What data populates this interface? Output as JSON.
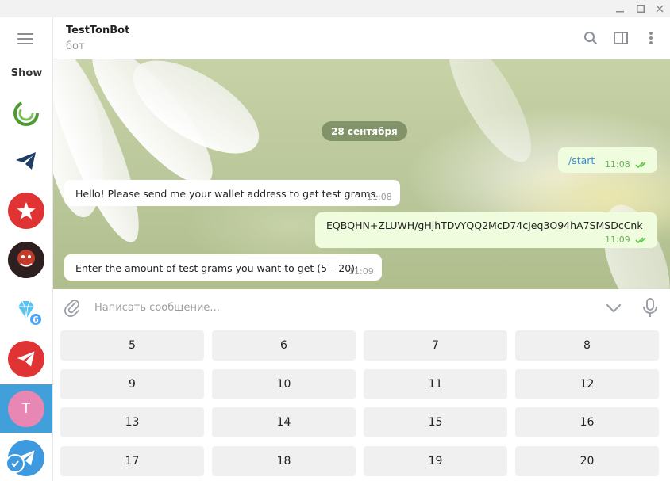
{
  "window": {
    "controls": [
      "minimize",
      "maximize",
      "close"
    ]
  },
  "sidebar": {
    "menu_icon": "hamburger-menu-icon",
    "show_label": "Show",
    "chats": [
      {
        "name": "chat-folder-green",
        "icon": "green-swirl-logo",
        "color": "#5a9a3c"
      },
      {
        "name": "chat-telegram-dark",
        "icon": "paper-plane-icon",
        "color": "#1f3e66"
      },
      {
        "name": "chat-star",
        "icon": "star-icon",
        "color": "#e03434"
      },
      {
        "name": "chat-avatar-photo",
        "icon": "photo-avatar",
        "color": "#3a2a2a"
      },
      {
        "name": "chat-diamond",
        "icon": "diamond-icon",
        "color": "#56c3f0",
        "badge": "6"
      },
      {
        "name": "chat-telegram-red",
        "icon": "paper-plane-icon",
        "color": "#e03434"
      },
      {
        "name": "chat-testtonbot",
        "letter": "T",
        "color": "#e887b4",
        "active": true
      },
      {
        "name": "chat-telegram-blue",
        "icon": "paper-plane-icon",
        "color": "#3d9ae0",
        "verified": true
      }
    ]
  },
  "header": {
    "title": "TestTonBot",
    "subtitle": "бот",
    "icons": [
      "search-icon",
      "sidebar-toggle-icon",
      "more-vertical-icon"
    ]
  },
  "messages": {
    "date": "28 сентября",
    "items": [
      {
        "dir": "out",
        "text": "/start",
        "time": "11:08",
        "read": true
      },
      {
        "dir": "in",
        "text": "Hello! Please send me your wallet address to get test grams.",
        "time": "11:08"
      },
      {
        "dir": "out",
        "text": "EQBQHN+ZLUWH/gHjhTDvYQQ2McD74cJeq3O94hA7SMSDcCnk",
        "time": "11:09",
        "read": true
      },
      {
        "dir": "in",
        "text": "Enter the amount of test grams you want to get (5 – 20):",
        "time": "11:09"
      }
    ]
  },
  "compose": {
    "placeholder": "Написать сообщение..."
  },
  "keyboard": {
    "rows": [
      [
        "5",
        "6",
        "7",
        "8"
      ],
      [
        "9",
        "10",
        "11",
        "12"
      ],
      [
        "13",
        "14",
        "15",
        "16"
      ],
      [
        "17",
        "18",
        "19",
        "20"
      ]
    ]
  },
  "colors": {
    "accent": "#419fd9",
    "outgoing_bubble": "#effdde",
    "read_ticks": "#5ec245"
  }
}
